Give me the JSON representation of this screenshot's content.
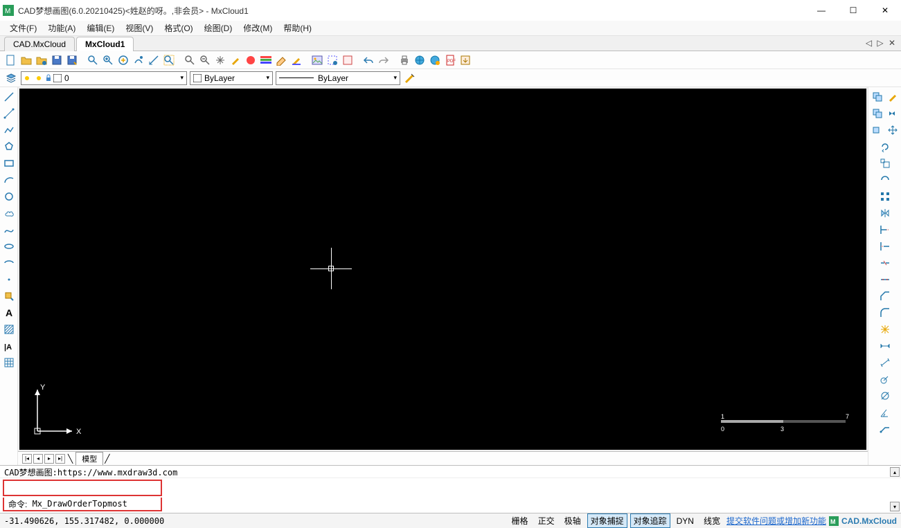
{
  "title": "CAD梦想画图(6.0.20210425)<姓赵的呀。,非会员> - MxCloud1",
  "menus": [
    "文件(F)",
    "功能(A)",
    "编辑(E)",
    "视图(V)",
    "格式(O)",
    "绘图(D)",
    "修改(M)",
    "帮助(H)"
  ],
  "tabs": [
    "CAD.MxCloud",
    "MxCloud1"
  ],
  "activeTab": 1,
  "tabNav": "◁ ▷ ✕",
  "layer": {
    "current": "0",
    "bylayer1": "ByLayer",
    "bylayer2": "ByLayer"
  },
  "cmd": {
    "log": "CAD梦想画图:https://www.mxdraw3d.com",
    "prompt": "命令:",
    "input": "Mx_DrawOrderTopmost"
  },
  "status": {
    "coords": "-31.490626, 155.317482, 0.000000",
    "btns": [
      "栅格",
      "正交",
      "极轴",
      "对象捕捉",
      "对象追踪",
      "DYN",
      "线宽"
    ],
    "on": [
      3,
      4
    ],
    "link": "提交软件问题或增加新功能",
    "brand": "CAD.MxCloud"
  },
  "modelTab": "模型",
  "scale": {
    "l": "1",
    "m": "0",
    "r": "7",
    "b": "3"
  },
  "ucs": {
    "y": "Y",
    "x": "X"
  }
}
